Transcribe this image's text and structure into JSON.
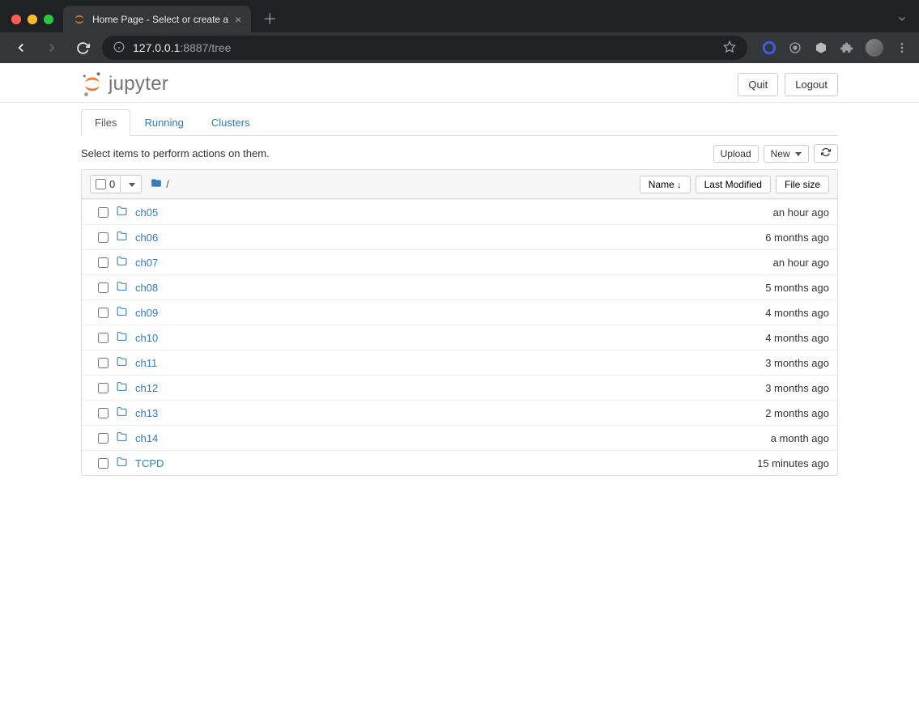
{
  "browser": {
    "tab_title": "Home Page - Select or create a",
    "url_host": "127.0.0.1",
    "url_port_path": ":8887/tree"
  },
  "header": {
    "logo_text": "jupyter",
    "quit": "Quit",
    "logout": "Logout"
  },
  "tabs": {
    "files": "Files",
    "running": "Running",
    "clusters": "Clusters"
  },
  "toolbar": {
    "help_text": "Select items to perform actions on them.",
    "upload": "Upload",
    "new": "New",
    "select_count": "0",
    "name_col": "Name",
    "modified_col": "Last Modified",
    "size_col": "File size",
    "breadcrumb_root": "/"
  },
  "files": [
    {
      "name": "ch05",
      "modified": "an hour ago"
    },
    {
      "name": "ch06",
      "modified": "6 months ago"
    },
    {
      "name": "ch07",
      "modified": "an hour ago"
    },
    {
      "name": "ch08",
      "modified": "5 months ago"
    },
    {
      "name": "ch09",
      "modified": "4 months ago"
    },
    {
      "name": "ch10",
      "modified": "4 months ago"
    },
    {
      "name": "ch11",
      "modified": "3 months ago"
    },
    {
      "name": "ch12",
      "modified": "3 months ago"
    },
    {
      "name": "ch13",
      "modified": "2 months ago"
    },
    {
      "name": "ch14",
      "modified": "a month ago"
    },
    {
      "name": "TCPD",
      "modified": "15 minutes ago"
    }
  ]
}
